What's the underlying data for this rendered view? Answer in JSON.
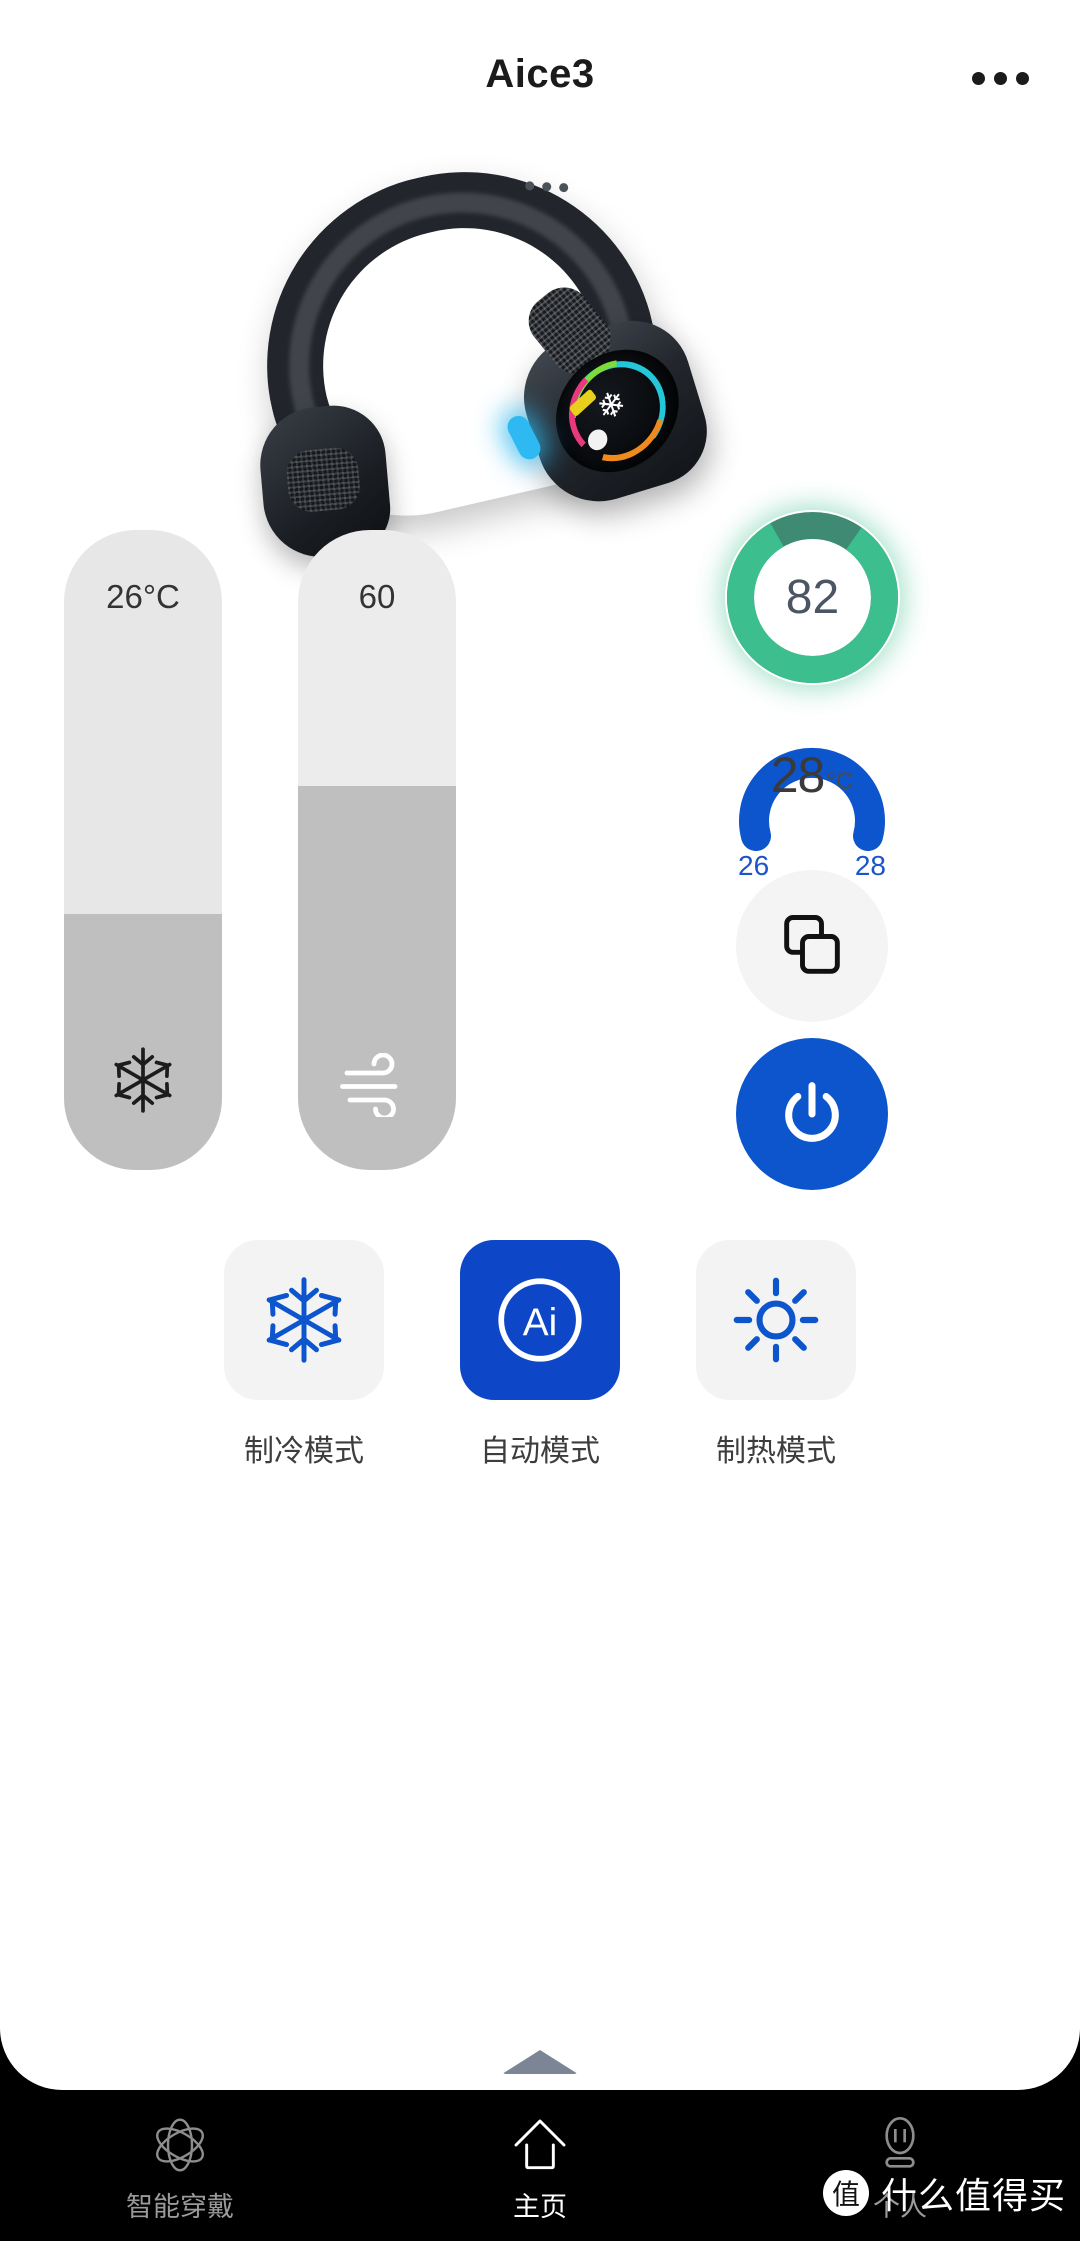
{
  "header": {
    "title": "Aice3",
    "more_icon": "more-horizontal-icon"
  },
  "device": {
    "image_alt": "neck-cooler-device",
    "screen_icon": "snowflake-icon"
  },
  "controls": {
    "temperature_slider": {
      "value": "26°C",
      "fill_percent": 40,
      "icon": "snowflake-icon"
    },
    "fan_slider": {
      "value": "60",
      "fill_percent": 60,
      "icon": "wind-icon"
    },
    "battery": {
      "value": "82",
      "percent": 82,
      "color": "#3dbe8f",
      "track_color": "#3f8a72"
    },
    "temperature_gauge": {
      "value": "28",
      "unit": "°C",
      "min_label": "26",
      "max_label": "28",
      "color": "#0d55cd"
    },
    "mirror_button": {
      "icon": "screen-mirror-icon"
    },
    "power_button": {
      "icon": "power-icon",
      "color": "#0d55cd"
    }
  },
  "modes": [
    {
      "label": "制冷模式",
      "icon": "snowflake-icon",
      "active": false
    },
    {
      "label": "自动模式",
      "icon": "ai-circle-icon",
      "active": true
    },
    {
      "label": "制热模式",
      "icon": "sun-icon",
      "active": false
    }
  ],
  "bottom_nav": [
    {
      "label": "智能穿戴",
      "icon": "atom-icon",
      "active": false
    },
    {
      "label": "主页",
      "icon": "home-icon",
      "active": true
    },
    {
      "label": "个人",
      "icon": "person-icon",
      "active": false
    }
  ],
  "watermark": {
    "logo_text": "值",
    "text": "什么值得买"
  }
}
